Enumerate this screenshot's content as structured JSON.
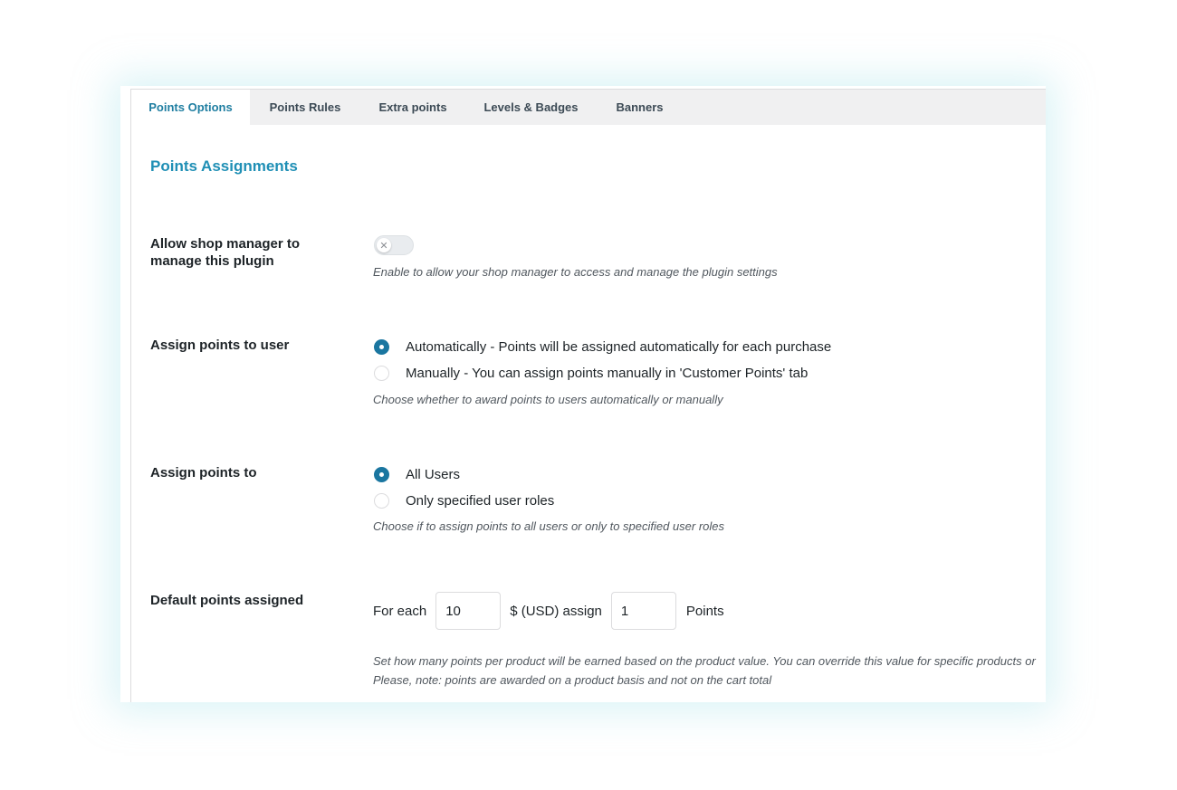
{
  "tabs": [
    {
      "label": "Points Options",
      "active": true
    },
    {
      "label": "Points Rules",
      "active": false
    },
    {
      "label": "Extra points",
      "active": false
    },
    {
      "label": "Levels & Badges",
      "active": false
    },
    {
      "label": "Banners",
      "active": false
    }
  ],
  "section_title": "Points Assignments",
  "shop_manager": {
    "label": "Allow shop manager to manage this plugin",
    "toggle_on": false,
    "toggle_glyph": "✕",
    "description": "Enable to allow your shop manager to access and manage the plugin settings"
  },
  "assign_user": {
    "label": "Assign points to user",
    "options": [
      {
        "label": "Automatically - Points will be assigned automatically for each purchase",
        "checked": true
      },
      {
        "label": "Manually - You can assign points manually in 'Customer Points' tab",
        "checked": false
      }
    ],
    "description": "Choose whether to award points to users automatically or manually"
  },
  "assign_to": {
    "label": "Assign points to",
    "options": [
      {
        "label": "All Users",
        "checked": true
      },
      {
        "label": "Only specified user roles",
        "checked": false
      }
    ],
    "description": "Choose if to assign points to all users or only to specified user roles"
  },
  "default_points": {
    "label": "Default points assigned",
    "prefix": "For each",
    "amount_value": "10",
    "middle": "$ (USD) assign",
    "points_value": "1",
    "suffix": "Points",
    "description_line1": "Set how many points per product will be earned based on the product value. You can override this value for specific products or",
    "description_line2": "Please, note: points are awarded on a product basis and not on the cart total"
  },
  "colors": {
    "accent": "#1f8fb5",
    "radio_checked": "#1a76a0",
    "tab_bar": "#f0f0f1"
  }
}
